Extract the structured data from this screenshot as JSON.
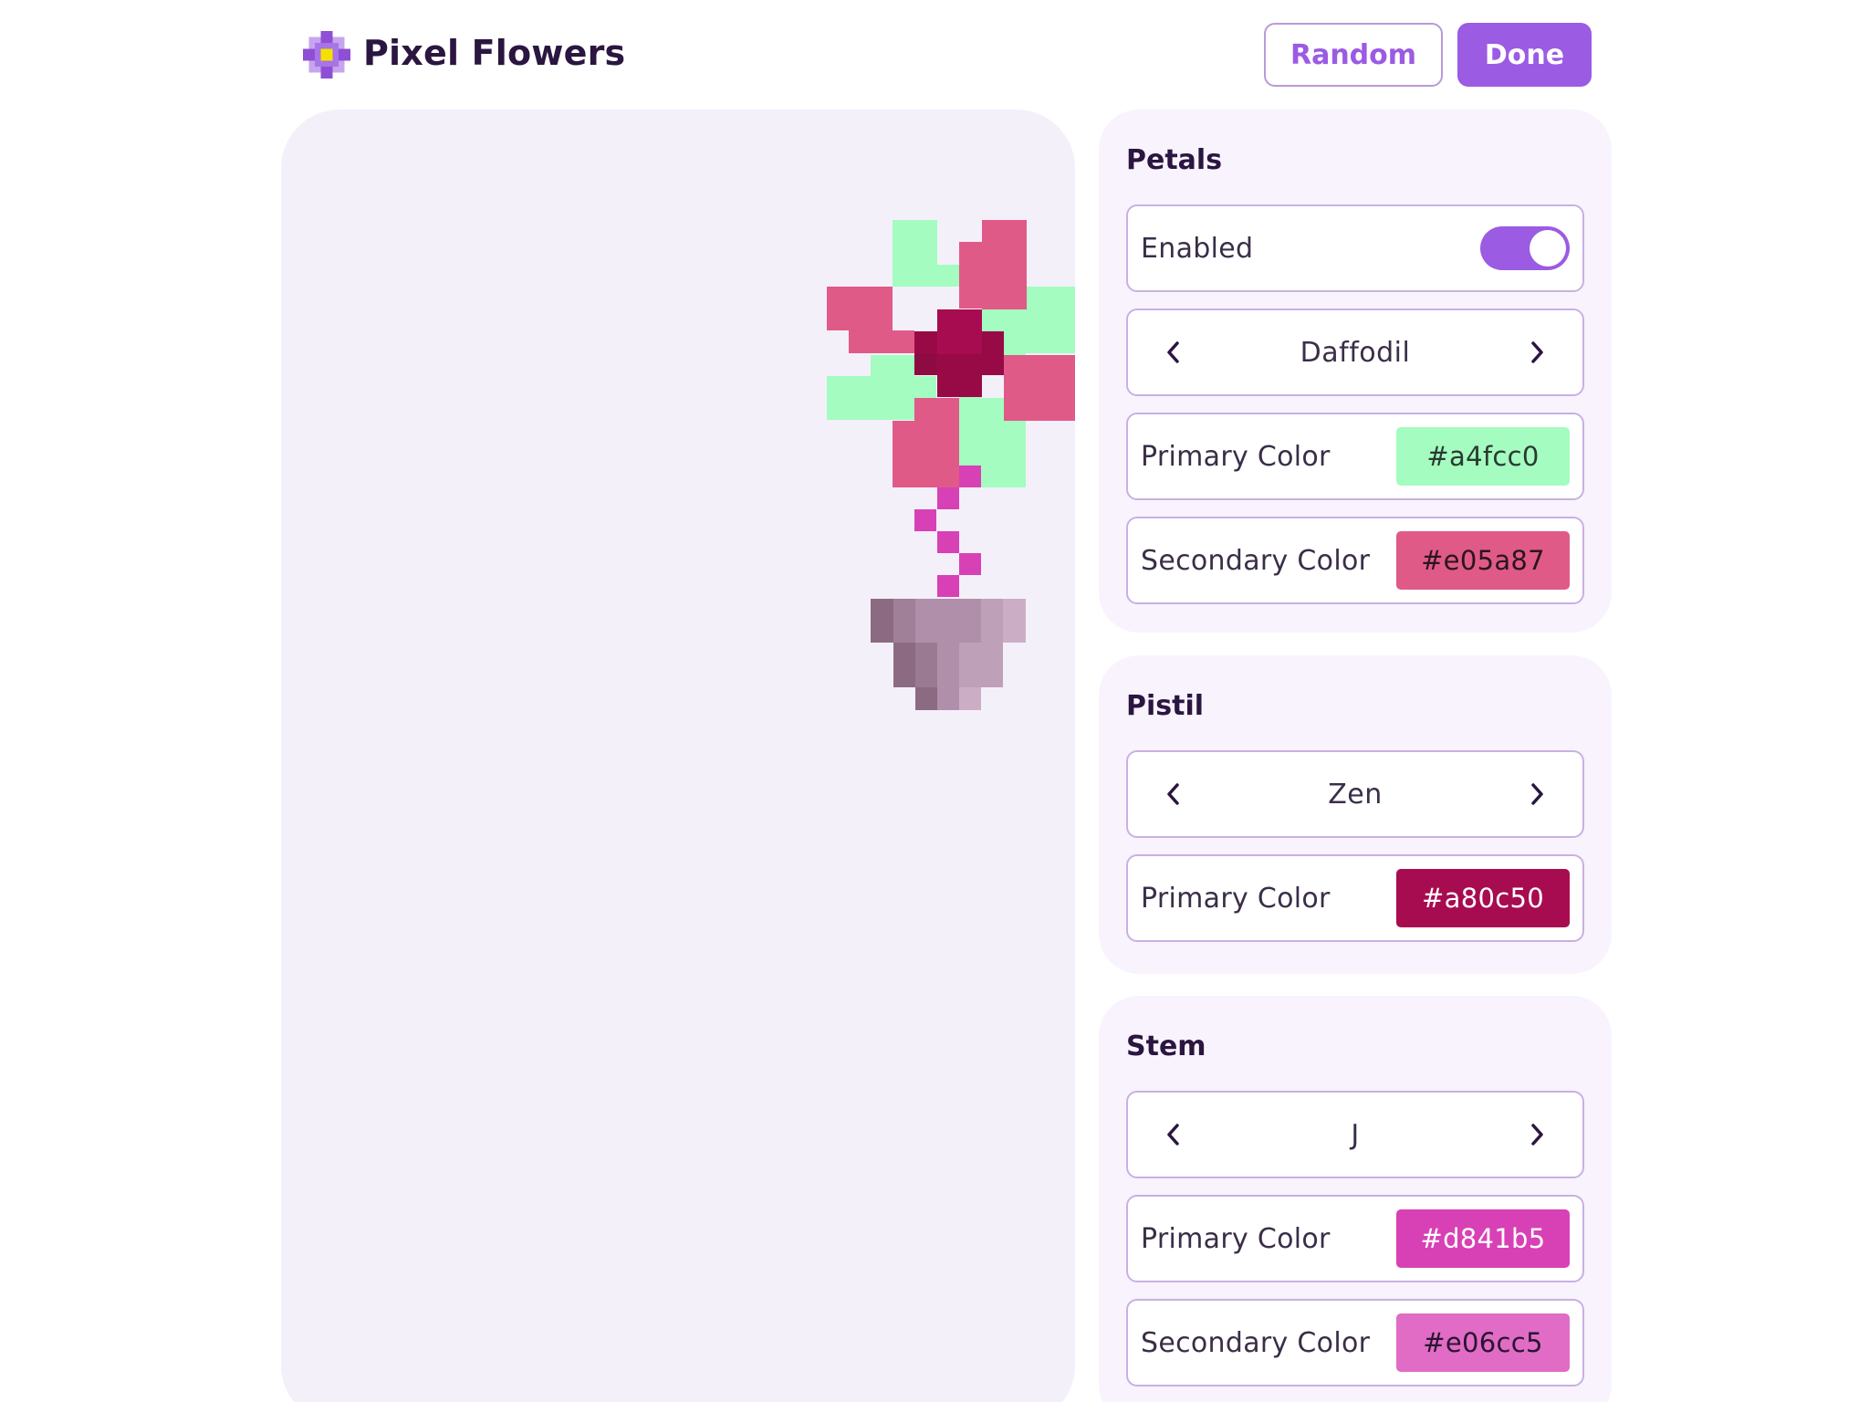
{
  "app": {
    "title": "Pixel Flowers",
    "logo_icon": "pixel-flower-logo-icon"
  },
  "toolbar": {
    "random_label": "Random",
    "done_label": "Done"
  },
  "colors": {
    "accent": "#9b5be3",
    "panel_bg": "#f4f0fa",
    "section_bg": "#f8f3fd"
  },
  "petals": {
    "title": "Petals",
    "enabled_label": "Enabled",
    "enabled": true,
    "style": "Daffodil",
    "primary_label": "Primary Color",
    "primary_color": "#a4fcc0",
    "secondary_label": "Secondary Color",
    "secondary_color": "#e05a87"
  },
  "pistil": {
    "title": "Pistil",
    "style": "Zen",
    "primary_label": "Primary Color",
    "primary_color": "#a80c50"
  },
  "stem": {
    "title": "Stem",
    "style": "J",
    "primary_label": "Primary Color",
    "primary_color": "#d841b5",
    "secondary_label": "Secondary Color",
    "secondary_color": "#e06cc5"
  }
}
